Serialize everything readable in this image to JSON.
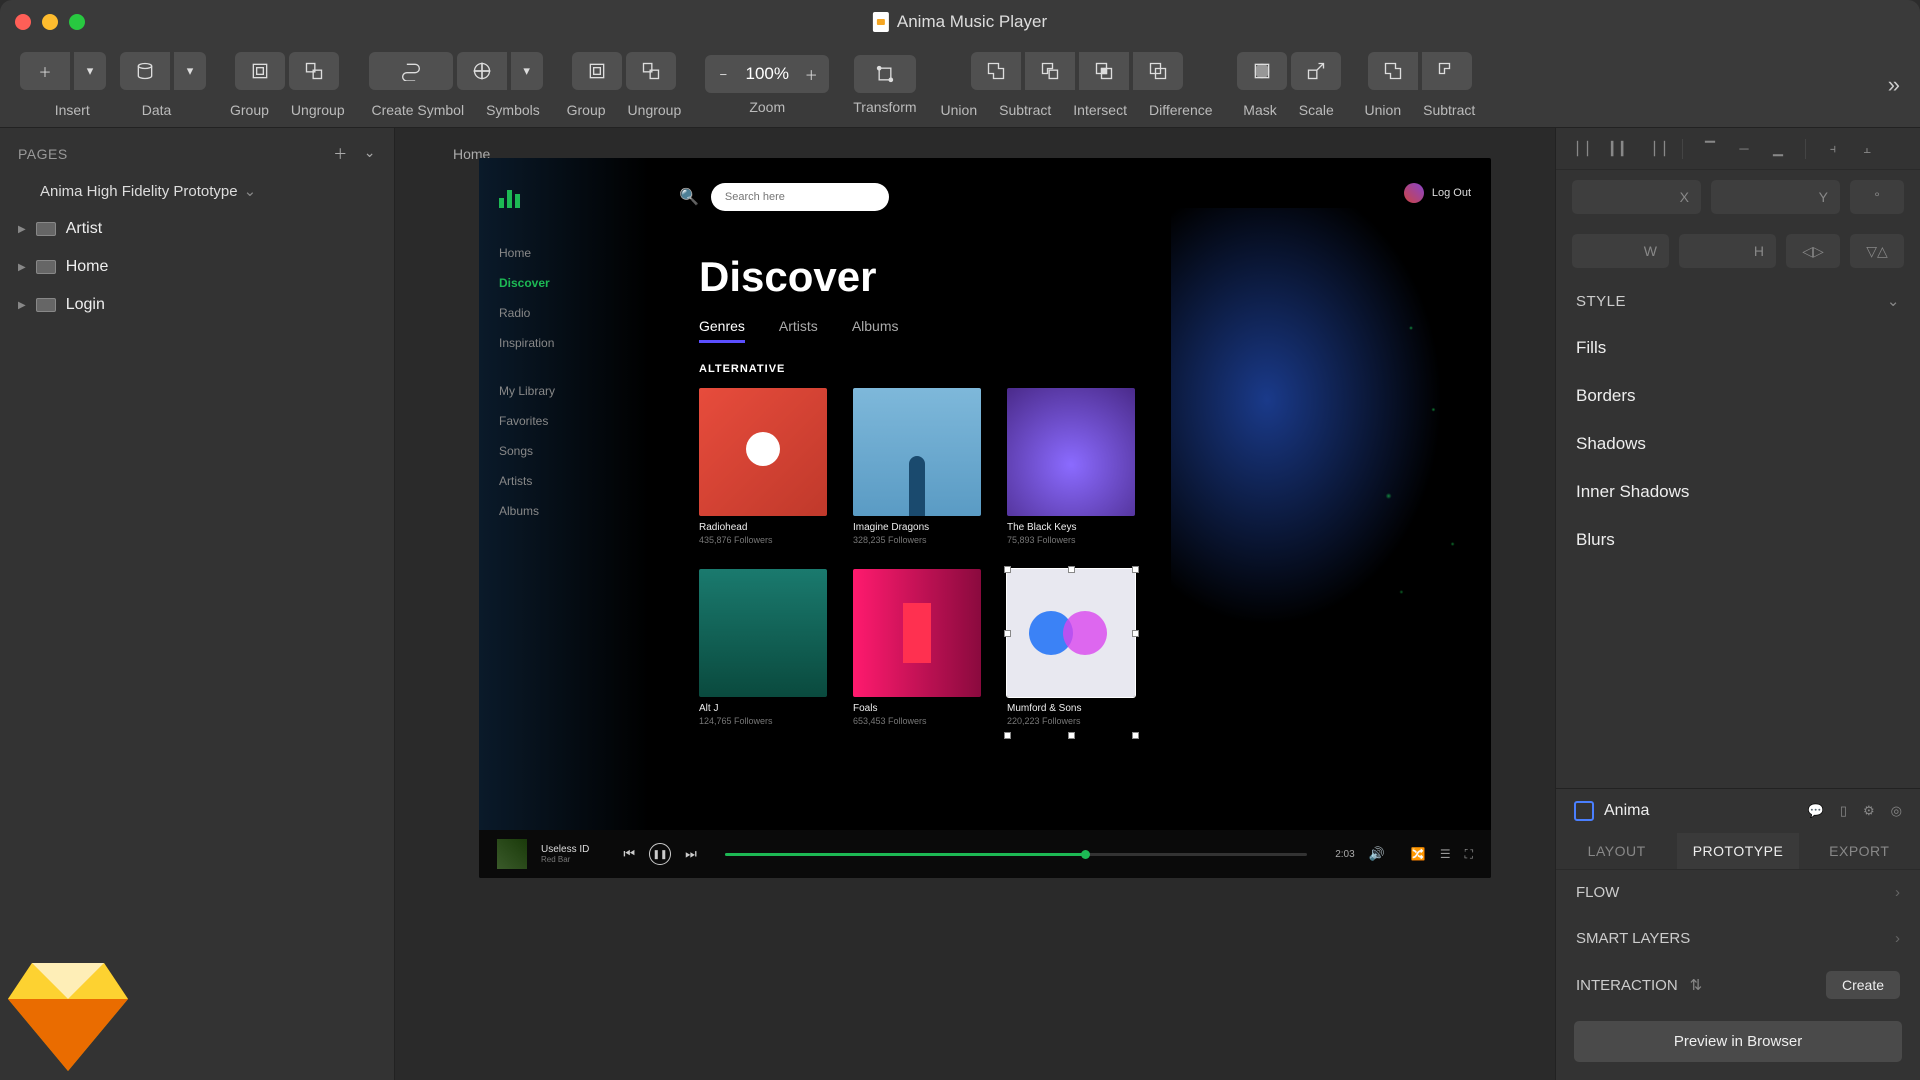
{
  "window": {
    "title": "Anima Music Player"
  },
  "toolbar": {
    "insert": "Insert",
    "data": "Data",
    "group": "Group",
    "ungroup": "Ungroup",
    "create_symbol": "Create Symbol",
    "symbols": "Symbols",
    "group2": "Group",
    "ungroup2": "Ungroup",
    "zoom": "Zoom",
    "zoom_value": "100%",
    "transform": "Transform",
    "union": "Union",
    "subtract": "Subtract",
    "intersect": "Intersect",
    "difference": "Difference",
    "mask": "Mask",
    "scale": "Scale",
    "union2": "Union",
    "subtract2": "Subtract"
  },
  "pages": {
    "header": "PAGES",
    "current": "Anima High Fidelity Prototype",
    "layers": [
      "Artist",
      "Home",
      "Login"
    ]
  },
  "canvas": {
    "artboard_label": "Home",
    "search_placeholder": "Search here",
    "logout": "Log Out",
    "nav": {
      "home": "Home",
      "discover": "Discover",
      "radio": "Radio",
      "inspiration": "Inspiration",
      "my_library": "My Library",
      "favorites": "Favorites",
      "songs": "Songs",
      "artists": "Artists",
      "albums": "Albums"
    },
    "title": "Discover",
    "tabs": {
      "genres": "Genres",
      "artists": "Artists",
      "albums": "Albums"
    },
    "section": "ALTERNATIVE",
    "cards": [
      {
        "title": "Radiohead",
        "sub": "435,876 Followers"
      },
      {
        "title": "Imagine Dragons",
        "sub": "328,235 Followers"
      },
      {
        "title": "The Black Keys",
        "sub": "75,893 Followers"
      },
      {
        "title": "Alt J",
        "sub": "124,765 Followers"
      },
      {
        "title": "Foals",
        "sub": "653,453 Followers"
      },
      {
        "title": "Mumford & Sons",
        "sub": "220,223 Followers"
      }
    ],
    "player": {
      "title": "Useless ID",
      "sub": "Red Bar",
      "time": "2:03"
    }
  },
  "inspector": {
    "x": "X",
    "y": "Y",
    "deg": "°",
    "w": "W",
    "h": "H",
    "style": "STYLE",
    "fills": "Fills",
    "borders": "Borders",
    "shadows": "Shadows",
    "inner_shadows": "Inner Shadows",
    "blurs": "Blurs"
  },
  "anima": {
    "name": "Anima",
    "tabs": {
      "layout": "LAYOUT",
      "prototype": "PROTOTYPE",
      "export": "EXPORT"
    },
    "flow": "FLOW",
    "smart_layers": "SMART LAYERS",
    "interaction": "INTERACTION",
    "create": "Create",
    "preview": "Preview in Browser"
  }
}
